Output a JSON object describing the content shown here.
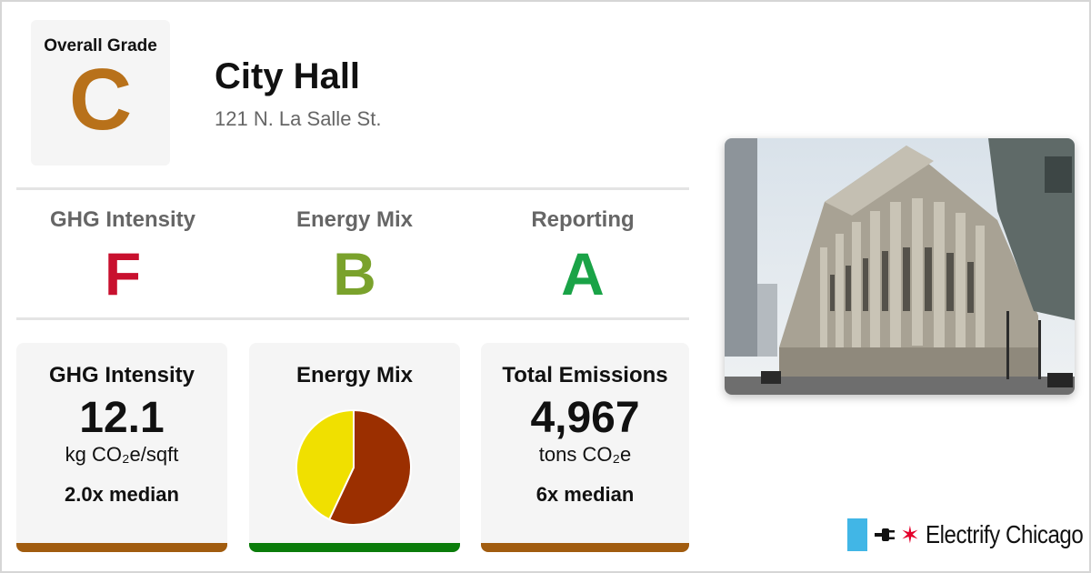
{
  "overall": {
    "label": "Overall Grade",
    "grade": "C"
  },
  "building": {
    "name": "City Hall",
    "address": "121 N. La Salle St."
  },
  "subgrades": [
    {
      "label": "GHG Intensity",
      "grade": "F",
      "color": "#c8102e"
    },
    {
      "label": "Energy Mix",
      "grade": "B",
      "color": "#7aa22c"
    },
    {
      "label": "Reporting",
      "grade": "A",
      "color": "#1aa347"
    }
  ],
  "colors": {
    "overall_grade": "#b8711a",
    "bar_c_grade": "#a15c0f",
    "bar_b_grade": "#0a7c0a"
  },
  "cards": {
    "ghg": {
      "title": "GHG Intensity",
      "value": "12.1",
      "unit": "kg CO₂e/sqft",
      "median": "2.0x median"
    },
    "mix": {
      "title": "Energy Mix"
    },
    "emissions": {
      "title": "Total Emissions",
      "value": "4,967",
      "unit": "tons CO₂e",
      "median": "6x median"
    }
  },
  "chart_data": {
    "type": "pie",
    "slices": [
      {
        "value": 57,
        "color": "#9b2f00"
      },
      {
        "value": 43,
        "color": "#f0e000"
      }
    ]
  },
  "brand": {
    "name": "Electrify Chicago",
    "flag_color": "#41b6e6",
    "star_color": "#e4002b"
  }
}
